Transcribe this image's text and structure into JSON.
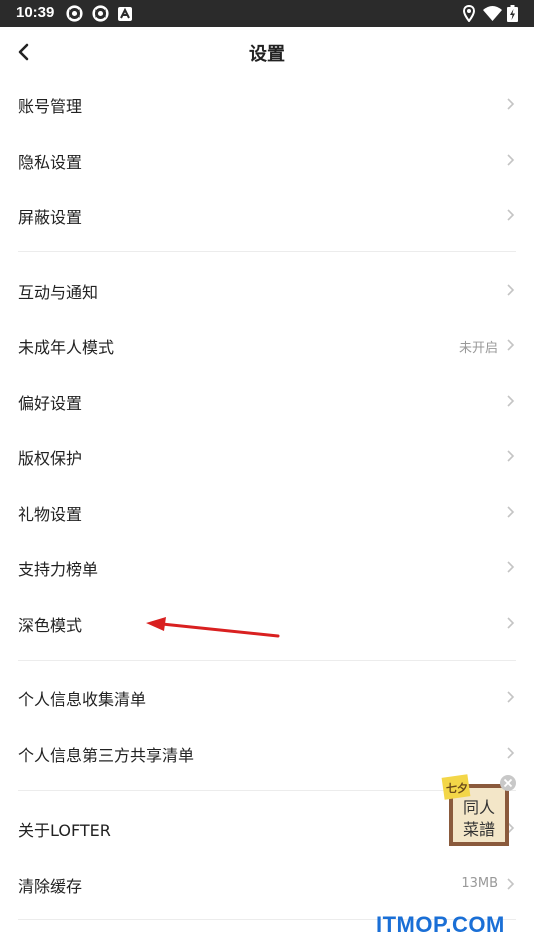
{
  "status_bar": {
    "time": "10:39",
    "icons": [
      "sync-icon",
      "sync-icon",
      "notification-a-icon",
      "location-icon",
      "wifi-icon",
      "battery-charging-icon"
    ]
  },
  "header": {
    "title": "设置",
    "back_icon": "chevron-left-icon"
  },
  "settings": {
    "account": {
      "label": "账号管理"
    },
    "privacy": {
      "label": "隐私设置"
    },
    "block": {
      "label": "屏蔽设置"
    },
    "interaction": {
      "label": "互动与通知"
    },
    "minor_mode": {
      "label": "未成年人模式",
      "value": "未开启"
    },
    "preference": {
      "label": "偏好设置"
    },
    "copyright": {
      "label": "版权保护"
    },
    "gift": {
      "label": "礼物设置"
    },
    "support": {
      "label": "支持力榜单"
    },
    "dark_mode": {
      "label": "深色模式"
    },
    "info_collect": {
      "label": "个人信息收集清单"
    },
    "third_party": {
      "label": "个人信息第三方共享清单"
    },
    "about": {
      "label": "关于LOFTER"
    },
    "cache": {
      "label": "清除缓存",
      "value": "13MB"
    }
  },
  "floating_ad": {
    "text_top": "同人",
    "text_bottom": "菜譜",
    "tag": "七夕",
    "close_icon": "close-icon"
  },
  "watermark": "ITMOP.COM",
  "colors": {
    "status_bar_bg": "#2b2b2b",
    "text": "#222222",
    "secondary_text": "#999999",
    "divider": "#ececec",
    "annotation_arrow": "#d92020",
    "watermark": "#1a6fd6"
  }
}
